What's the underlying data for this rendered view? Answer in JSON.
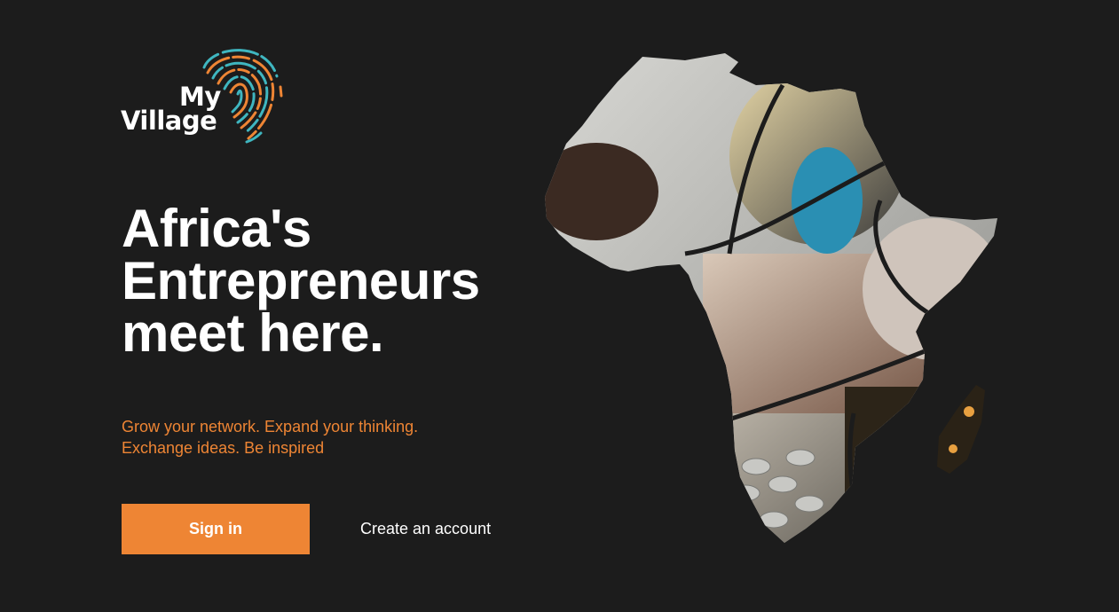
{
  "logo": {
    "line1": "My",
    "line2": "Village",
    "icon": "fingerprint-icon",
    "colors": {
      "teal": "#3fb6c0",
      "orange": "#ee8534"
    }
  },
  "hero": {
    "headline_lines": [
      "Africa's",
      "Entrepreneurs",
      "meet here."
    ],
    "tagline_lines": [
      "Grow your network. Expand your thinking.",
      "Exchange ideas. Be inspired"
    ]
  },
  "actions": {
    "signin_label": "Sign in",
    "create_account_label": "Create an account"
  },
  "colors": {
    "background": "#1c1c1c",
    "accent": "#ee8534",
    "text": "#ffffff"
  }
}
